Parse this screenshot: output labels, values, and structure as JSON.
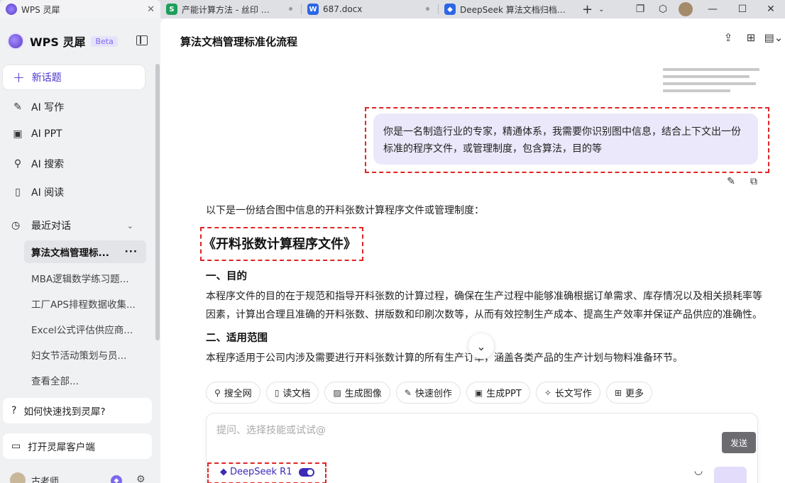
{
  "tabs": [
    {
      "label": "WPS 灵犀",
      "icon": "wps-lingxi-icon",
      "active": true
    },
    {
      "label": "产能计算方法 - 丝印 模板",
      "icon": "S",
      "color": "#1e9e5b"
    },
    {
      "label": "687.docx",
      "icon": "W",
      "color": "#2b66e6"
    },
    {
      "label": "DeepSeek 算法文档归档流程",
      "icon": "deepseek-icon",
      "color": "#2b66e6"
    }
  ],
  "window": {
    "new_tab": "+",
    "new_tab_chev": "⌄",
    "minimize": "—",
    "maximize": "☐",
    "close": "✕"
  },
  "sidebar": {
    "brand": "WPS 灵犀",
    "beta": "Beta",
    "new_chat": "新话题",
    "nav": [
      {
        "label": "AI 写作",
        "icon": "pen-icon"
      },
      {
        "label": "AI PPT",
        "icon": "ppt-icon"
      },
      {
        "label": "AI 搜索",
        "icon": "search-icon"
      },
      {
        "label": "AI 阅读",
        "icon": "read-icon"
      }
    ],
    "recent_label": "最近对话",
    "recent": [
      "算法文档管理标...",
      "MBA逻辑数学练习题...",
      "工厂APS排程数据收集...",
      "Excel公式评估供应商...",
      "妇女节活动策划与员...",
      "查看全部..."
    ],
    "more": "···",
    "help": "如何快速找到灵犀?",
    "client": "打开灵犀客户端",
    "user": "古老师"
  },
  "main": {
    "title": "算法文档管理标准化流程",
    "user_message": "你是一名制造行业的专家，精通体系，我需要你识别图中信息，结合上下文出一份标准的程序文件，或管理制度，包含算法，目的等",
    "intro": "以下是一份结合图中信息的开料张数计算程序文件或管理制度：",
    "doc_title": "《开料张数计算程序文件》",
    "sections": [
      {
        "heading": "一、目的",
        "text": "本程序文件的目的在于规范和指导开料张数的计算过程，确保在生产过程中能够准确根据订单需求、库存情况以及相关损耗率等因素，计算出合理且准确的开料张数、拼版数和印刷次数等，从而有效控制生产成本、提高生产效率并保证产品供应的准确性。"
      },
      {
        "heading": "二、适用范围",
        "text": "本程序适用于公司内涉及需要进行开料张数计算的所有生产订单，涵盖各类产品的生产计划与物料准备环节。"
      }
    ],
    "chips": [
      {
        "label": "搜全网",
        "icon": "search-web-icon"
      },
      {
        "label": "读文档",
        "icon": "read-doc-icon"
      },
      {
        "label": "生成图像",
        "icon": "image-gen-icon"
      },
      {
        "label": "快速创作",
        "icon": "quick-create-icon"
      },
      {
        "label": "生成PPT",
        "icon": "ppt-gen-icon"
      },
      {
        "label": "长文写作",
        "icon": "long-write-icon"
      },
      {
        "label": "更多",
        "icon": "more-grid-icon"
      }
    ],
    "input_placeholder": "提问、选择技能或试试@",
    "send": "发送",
    "model": "DeepSeek R1"
  },
  "colors": {
    "accent": "#4a35c9",
    "highlight_box": "#e02424",
    "bubble": "#ece8fb"
  }
}
